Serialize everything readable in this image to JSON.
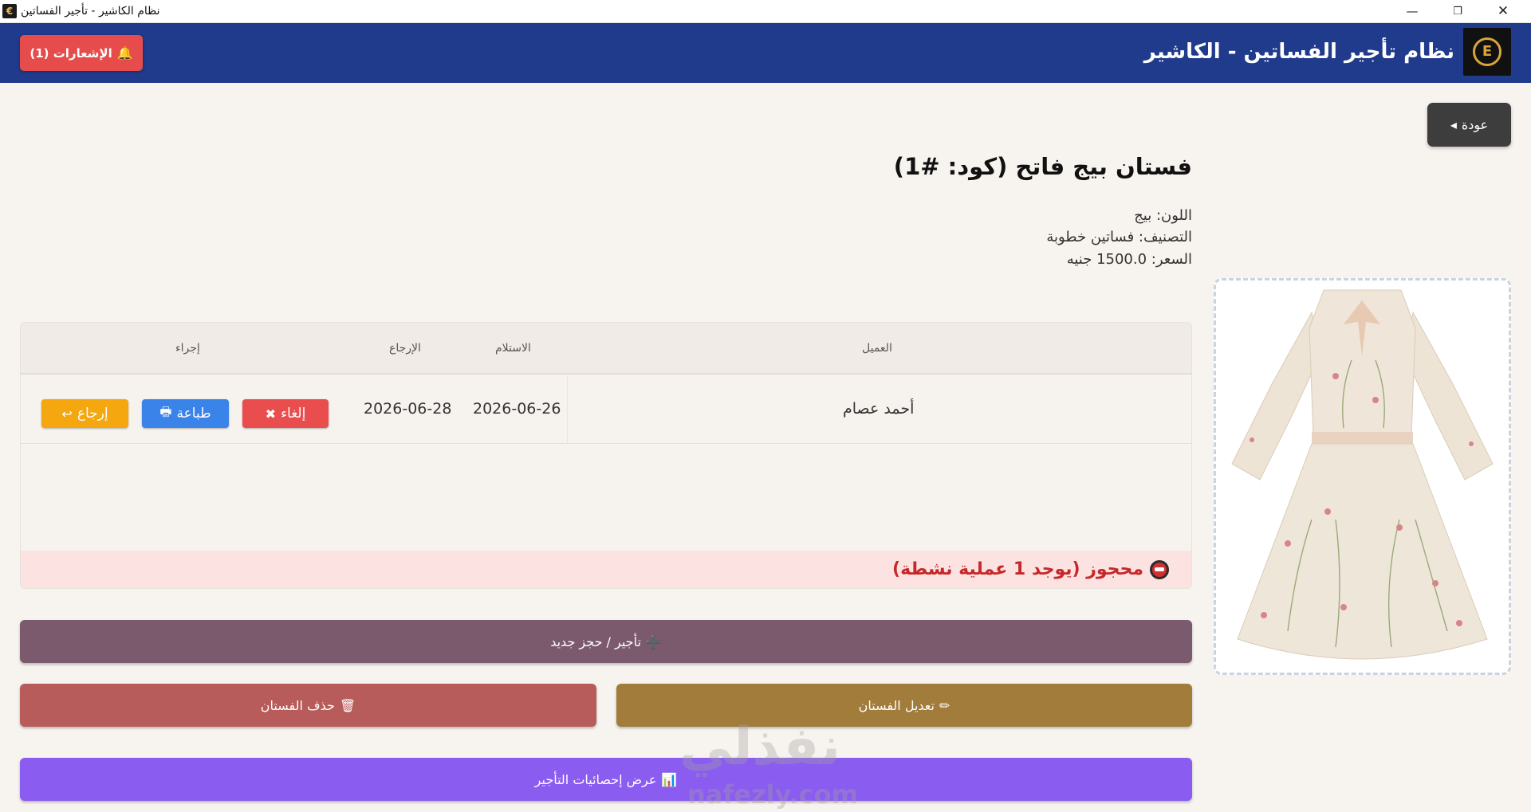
{
  "window": {
    "title": "نظام الكاشير - تأجير الفساتين",
    "min_glyph": "—",
    "max_glyph": "❐",
    "close_glyph": "✕"
  },
  "header": {
    "app_title": "نظام تأجير الفساتين - الكاشير",
    "logo_letter": "E",
    "notifications_label": "الإشعارات (1)",
    "bell_icon": "🔔"
  },
  "back": {
    "label": "عودة",
    "arrow": "◂"
  },
  "dress": {
    "name": "فستان بيج فاتح (كود: #1)",
    "color_line": "اللون: بيج",
    "category_line": "التصنيف: فساتين خطوبة",
    "price_line": "السعر: 1500.0 جنيه"
  },
  "table": {
    "headers": {
      "customer": "العميل",
      "pickup": "الاستلام",
      "return": "الإرجاع",
      "action": "إجراء"
    },
    "rows": [
      {
        "customer": "أحمد عصام",
        "pickup": "2026-06-26",
        "return": "2026-06-28",
        "actions": {
          "cancel": "إلغاء",
          "cancel_icon": "✖",
          "print": "طباعة",
          "print_icon": "🖶",
          "return_label": "إرجاع",
          "return_icon": "↩"
        }
      }
    ],
    "status": "محجوز (يوجد 1 عملية نشطة)"
  },
  "buttons": {
    "rent": {
      "label": "تأجير / حجز جديد",
      "icon": "➕"
    },
    "delete": {
      "label": "حذف الفستان",
      "icon": "🗑"
    },
    "edit": {
      "label": "تعديل الفستان",
      "icon": "✏"
    },
    "stats": {
      "label": "عرض إحصائيات التأجير",
      "icon": "📊"
    }
  },
  "watermark": {
    "ar": "نفذلي",
    "en": "nafezly.com"
  }
}
